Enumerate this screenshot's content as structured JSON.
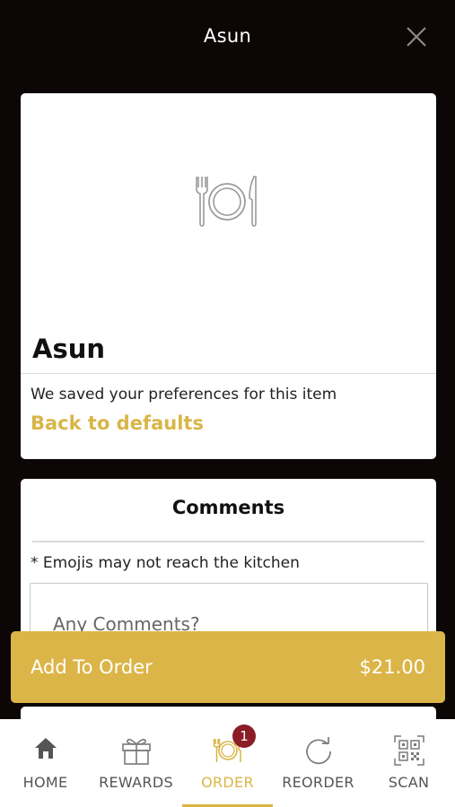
{
  "header": {
    "title": "Asun"
  },
  "item": {
    "name": "Asun",
    "saved_text": "We saved your preferences for this item",
    "defaults_link": "Back to defaults"
  },
  "comments": {
    "title": "Comments",
    "emoji_note": "* Emojis may not reach the kitchen",
    "placeholder": "Any Comments?"
  },
  "add_to_order": {
    "label": "Add To Order",
    "price": "$21.00"
  },
  "nav": {
    "items": [
      {
        "label": "HOME",
        "icon": "home-icon"
      },
      {
        "label": "REWARDS",
        "icon": "gift-icon"
      },
      {
        "label": "ORDER",
        "icon": "plate-icon",
        "active": true,
        "badge": "1"
      },
      {
        "label": "REORDER",
        "icon": "refresh-icon"
      },
      {
        "label": "SCAN",
        "icon": "qr-code-icon"
      }
    ]
  },
  "colors": {
    "background": "#0d0606",
    "accent": "#dbb547",
    "badge": "#8c1c26"
  }
}
